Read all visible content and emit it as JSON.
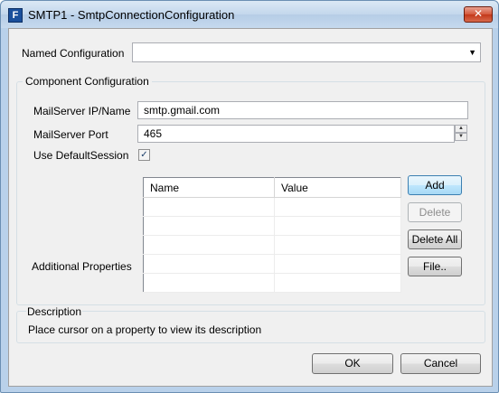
{
  "window": {
    "title": "SMTP1 - SmtpConnectionConfiguration",
    "app_icon": "F",
    "close_glyph": "✕"
  },
  "named_configuration": {
    "label": "Named Configuration",
    "value": ""
  },
  "component_configuration": {
    "title": "Component Configuration",
    "mailserver_ip_label": "MailServer IP/Name",
    "mailserver_ip_value": "smtp.gmail.com",
    "mailserver_port_label": "MailServer Port",
    "mailserver_port_value": "465",
    "use_default_session_label": "Use DefaultSession",
    "use_default_session_checked": true,
    "additional_properties_label": "Additional Properties",
    "properties_table": {
      "columns": [
        "Name",
        "Value"
      ],
      "rows": [
        [
          "",
          ""
        ],
        [
          "",
          ""
        ],
        [
          "",
          ""
        ],
        [
          "",
          ""
        ],
        [
          "",
          ""
        ]
      ]
    },
    "buttons": {
      "add": "Add",
      "delete": "Delete",
      "delete_all": "Delete All",
      "file": "File.."
    }
  },
  "description": {
    "title": "Description",
    "text": "Place cursor on a property to view its description"
  },
  "footer": {
    "ok": "OK",
    "cancel": "Cancel"
  },
  "icons": {
    "checkmark": "✓",
    "dropdown": "▼",
    "spin_up": "▲",
    "spin_down": "▼"
  }
}
